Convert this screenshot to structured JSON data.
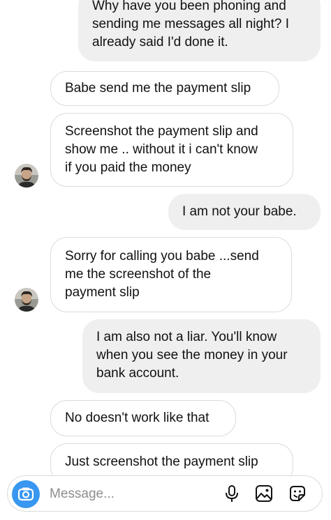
{
  "messages": [
    {
      "side": "sent",
      "lines": [
        "Why have you been phoning and",
        "sending me messages all night? I",
        "already said I'd done it."
      ]
    },
    {
      "side": "received",
      "lines": [
        "Babe send me the payment slip"
      ]
    },
    {
      "side": "received",
      "lines": [
        "Screenshot the payment slip and",
        "show me .. without it i can't know",
        "if you paid the money"
      ]
    },
    {
      "side": "sent",
      "lines": [
        "I am not your babe."
      ]
    },
    {
      "side": "received",
      "lines": [
        "Sorry for calling you babe ...send",
        "me the screenshot of the",
        "payment slip"
      ]
    },
    {
      "side": "sent",
      "lines": [
        "I am also not a liar. You'll know",
        "when you see the money in your",
        "bank account."
      ]
    },
    {
      "side": "received",
      "lines": [
        "No doesn't work like that"
      ]
    },
    {
      "side": "received",
      "lines": [
        "Just screenshot the payment slip"
      ]
    }
  ],
  "composer": {
    "placeholder": "Message...",
    "icons": [
      "camera-icon",
      "microphone-icon",
      "gallery-icon",
      "sticker-icon"
    ]
  },
  "colors": {
    "sent_bubble": "#efefef",
    "received_border": "#dbdbdb",
    "camera_button": "#3897f0",
    "placeholder_text": "#8e8e8e"
  }
}
